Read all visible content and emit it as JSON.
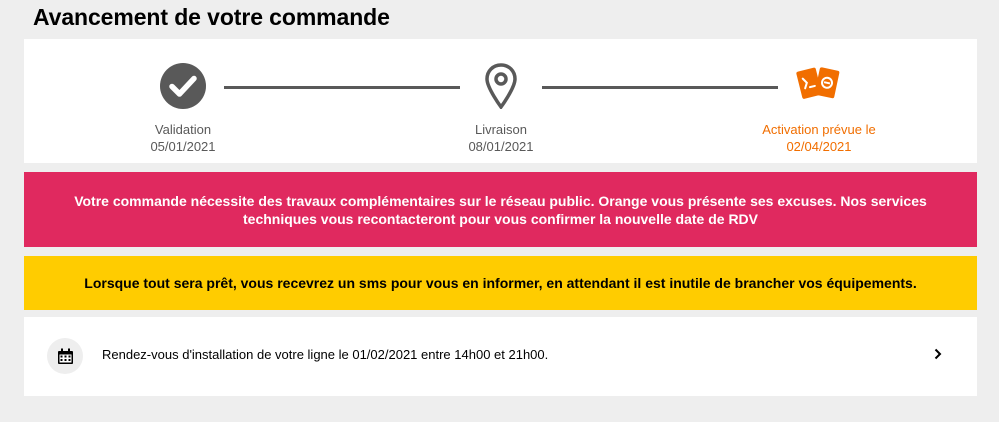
{
  "page": {
    "title": "Avancement de votre commande"
  },
  "steps": [
    {
      "label": "Validation",
      "date": "05/01/2021",
      "icon": "check-circle-icon",
      "state": "done"
    },
    {
      "label": "Livraison",
      "date": "08/01/2021",
      "icon": "map-pin-icon",
      "state": "done"
    },
    {
      "label": "Activation prévue le",
      "date": "02/04/2021",
      "icon": "activation-icon",
      "state": "current"
    }
  ],
  "alerts": {
    "red": {
      "text": "Votre commande nécessite des travaux complémentaires sur le réseau public. Orange vous présente ses excuses. Nos services techniques vous recontacteront pour vous confirmer la nouvelle date de RDV",
      "color": "#e0295f"
    },
    "yellow": {
      "text": "Lorsque tout sera prêt, vous recevrez un sms pour vous en informer, en attendant il est inutile de brancher vos équipements.",
      "color": "#ffcc00"
    }
  },
  "appointment": {
    "text": "Rendez-vous d'installation de votre ligne le 01/02/2021 entre 14h00 et 21h00.",
    "icon": "calendar-icon",
    "action_icon": "chevron-right-icon"
  },
  "colors": {
    "accent": "#f16e00",
    "neutral": "#595959",
    "background": "#eeeeee"
  }
}
